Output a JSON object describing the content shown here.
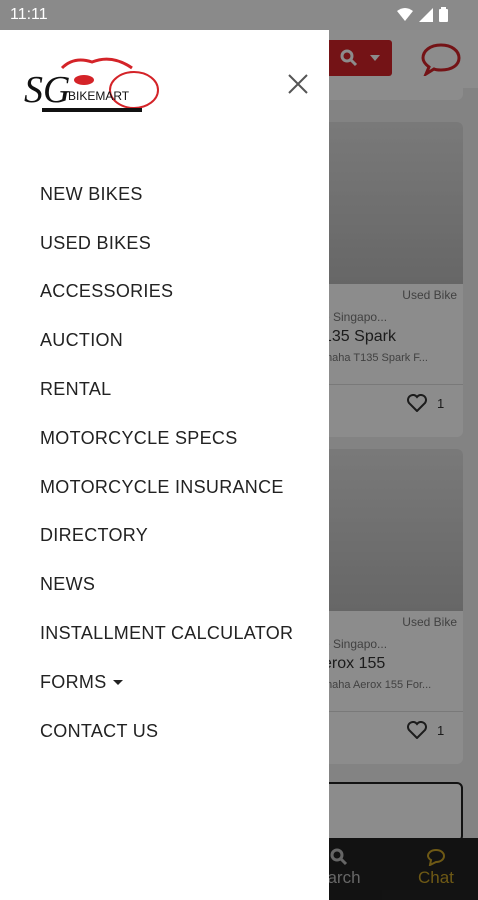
{
  "status_bar": {
    "time": "11:11"
  },
  "drawer": {
    "logo": {
      "main": "SG",
      "wordmark": "BIKEMART"
    },
    "menu": [
      {
        "label": "NEW BIKES"
      },
      {
        "label": "USED BIKES"
      },
      {
        "label": "ACCESSORIES"
      },
      {
        "label": "AUCTION"
      },
      {
        "label": "RENTAL"
      },
      {
        "label": "MOTORCYCLE SPECS"
      },
      {
        "label": "MOTORCYCLE INSURANCE"
      },
      {
        "label": "DIRECTORY"
      },
      {
        "label": "NEWS"
      },
      {
        "label": "INSTALLMENT CALCULATOR"
      },
      {
        "label": "FORMS",
        "has_dropdown": true
      },
      {
        "label": "CONTACT US"
      }
    ]
  },
  "listings": [
    {
      "tag": "Used Bike",
      "location": "e Singapo...",
      "title": "135 Spark",
      "description": "maha T135 Spark F...",
      "likes": "1"
    },
    {
      "tag": "Used Bike",
      "location": "e Singapo...",
      "title": "erox 155",
      "description": "maha Aerox 155 For...",
      "likes": "1"
    }
  ],
  "bottom_nav": {
    "search_label": "earch",
    "chat_label": "Chat"
  },
  "colors": {
    "brand_red": "#d42328",
    "chat_gold": "#c9a227",
    "nav_dark": "#222222"
  }
}
